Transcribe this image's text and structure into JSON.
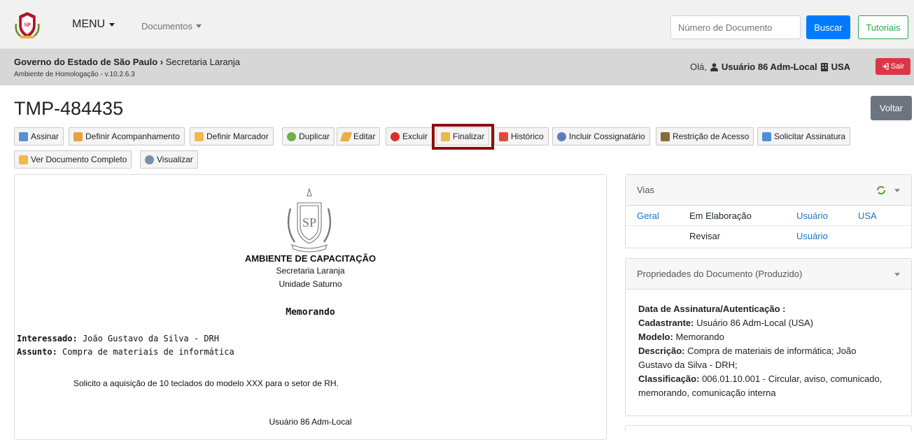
{
  "navbar": {
    "menu_label": "MENU",
    "docs_label": "Documentos",
    "search_placeholder": "Número de Documento",
    "search_button": "Buscar",
    "tutorials_button": "Tutoriais"
  },
  "header": {
    "org": "Governo do Estado de São Paulo",
    "separator": "›",
    "secretaria": "Secretaria Laranja",
    "environment": "Ambiente de Homologação - v.10.2.6.3",
    "greeting_prefix": "Olá,",
    "user": "Usuário 86 Adm-Local",
    "unit": "USA",
    "logout": "Sair"
  },
  "document": {
    "title": "TMP-484435",
    "back_button": "Voltar"
  },
  "toolbar": {
    "assinar": "Assinar",
    "definir_acompanhamento": "Definir Acompanhamento",
    "definir_marcador": "Definir Marcador",
    "duplicar": "Duplicar",
    "editar": "Editar",
    "excluir": "Excluir",
    "finalizar": "Finalizar",
    "historico": "Histórico",
    "incluir_cossignatario": "Incluir Cossignatário",
    "restricao_acesso": "Restrição de Acesso",
    "solicitar_assinatura": "Solicitar Assinatura",
    "ver_documento_completo": "Ver Documento Completo",
    "visualizar": "Visualizar"
  },
  "doc_content": {
    "ambiente": "AMBIENTE DE CAPACITAÇÃO",
    "secretaria": "Secretaria Laranja",
    "unidade": "Unidade Saturno",
    "tipo": "Memorando",
    "interessado_label": "Interessado:",
    "interessado_value": "João Gustavo da Silva - DRH",
    "assunto_label": "Assunto:",
    "assunto_value": "Compra de materiais de informática",
    "body": "Solicito a aquisição de 10 teclados do modelo XXX para o setor de RH.",
    "signer": "Usuário 86 Adm-Local"
  },
  "vias": {
    "title": "Vias",
    "rows": [
      {
        "via": "Geral",
        "status": "Em Elaboração",
        "user": "Usuário",
        "unit": "USA"
      },
      {
        "via": "",
        "status": "Revisar",
        "user": "Usuário",
        "unit": ""
      }
    ]
  },
  "properties": {
    "title": "Propriedades do Documento (Produzido)",
    "data_label": "Data de Assinatura/Autenticação :",
    "cadastrante_label": "Cadastrante:",
    "cadastrante_value": "Usuário 86 Adm-Local (USA)",
    "modelo_label": "Modelo:",
    "modelo_value": "Memorando",
    "descricao_label": "Descrição:",
    "descricao_value_1": "Compra de materiais de informática; João",
    "descricao_value_2": "Gustavo da Silva - DRH;",
    "classificacao_label": "Classificação:",
    "classificacao_value_1": "006.01.10.001 - Circular, aviso, comunicado,",
    "classificacao_value_2": "memorando, comunicação interna"
  },
  "colors": {
    "primary": "#007bff",
    "success": "#28a745",
    "danger": "#dc3545",
    "secondary": "#6c757d",
    "highlight_border": "#8b0f0f"
  }
}
